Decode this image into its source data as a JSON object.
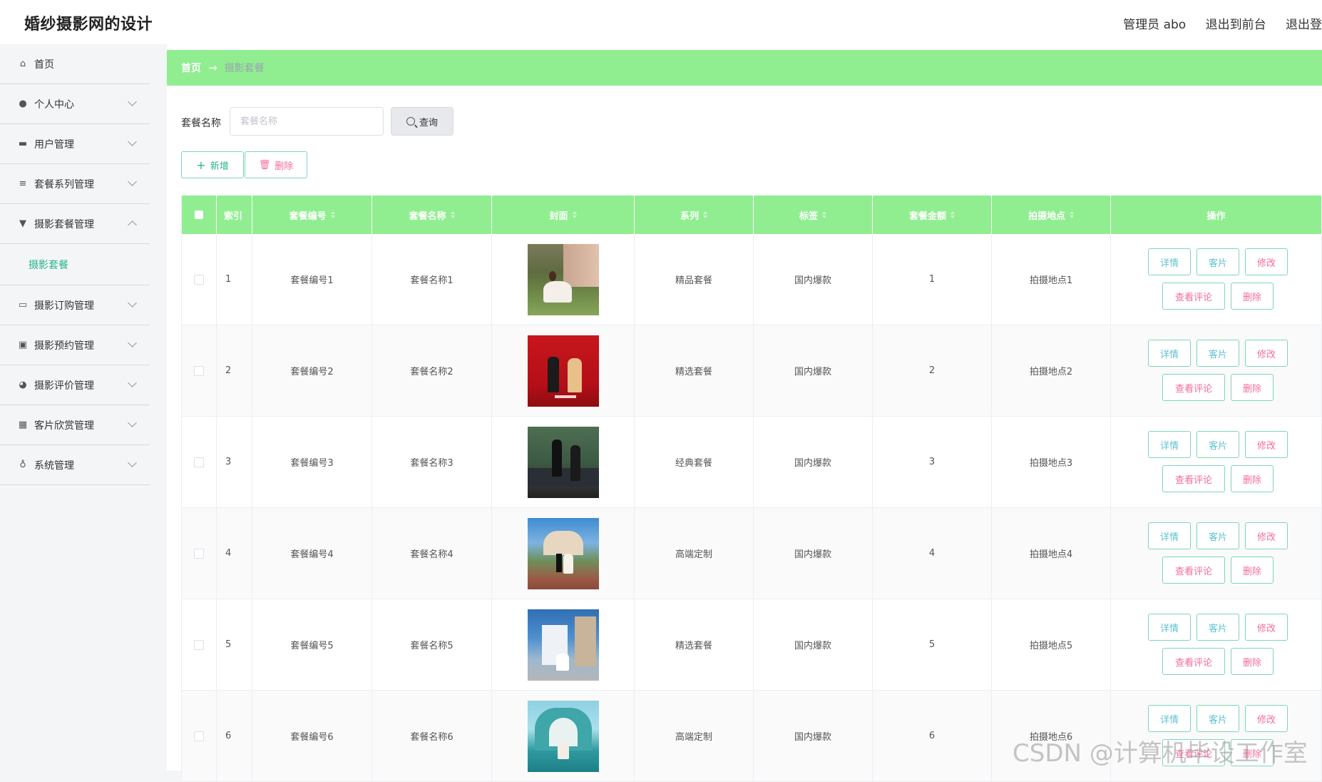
{
  "app": {
    "title": "婚纱摄影网的设计"
  },
  "header": {
    "admin_label": "管理员 abo",
    "to_front": "退出到前台",
    "logout": "退出登"
  },
  "sidebar": {
    "items": [
      {
        "label": "首页",
        "icon": "home-icon"
      },
      {
        "label": "个人中心",
        "icon": "user-icon"
      },
      {
        "label": "用户管理",
        "icon": "monitor-icon"
      },
      {
        "label": "套餐系列管理",
        "icon": "list-icon"
      },
      {
        "label": "摄影套餐管理",
        "icon": "brush-icon"
      },
      {
        "label": "摄影订购管理",
        "icon": "chat-icon"
      },
      {
        "label": "摄影预约管理",
        "icon": "clipboard-icon"
      },
      {
        "label": "摄影评价管理",
        "icon": "balloon-icon"
      },
      {
        "label": "客片欣赏管理",
        "icon": "grid-icon"
      },
      {
        "label": "系统管理",
        "icon": "mic-icon"
      }
    ],
    "active_sub": "摄影套餐"
  },
  "breadcrumb": {
    "home": "首页",
    "current": "摄影套餐"
  },
  "search": {
    "label": "套餐名称",
    "placeholder": "套餐名称",
    "value": "",
    "button": "查询"
  },
  "actions": {
    "add": "新增",
    "delete": "删除"
  },
  "table": {
    "headers": {
      "index": "索引",
      "code": "套餐编号",
      "name": "套餐名称",
      "cover": "封面",
      "series": "系列",
      "tag": "标签",
      "price": "套餐金额",
      "place": "拍摄地点",
      "ops": "操作"
    },
    "row_buttons": {
      "detail": "详情",
      "sample": "客片",
      "edit": "修改",
      "review": "查看评论",
      "delete": "删除"
    },
    "rows": [
      {
        "index": "1",
        "code": "套餐编号1",
        "name": "套餐名称1",
        "series": "精品套餐",
        "tag": "国内爆款",
        "price": "1",
        "place": "拍摄地点1"
      },
      {
        "index": "2",
        "code": "套餐编号2",
        "name": "套餐名称2",
        "series": "精选套餐",
        "tag": "国内爆款",
        "price": "2",
        "place": "拍摄地点2"
      },
      {
        "index": "3",
        "code": "套餐编号3",
        "name": "套餐名称3",
        "series": "经典套餐",
        "tag": "国内爆款",
        "price": "3",
        "place": "拍摄地点3"
      },
      {
        "index": "4",
        "code": "套餐编号4",
        "name": "套餐名称4",
        "series": "高端定制",
        "tag": "国内爆款",
        "price": "4",
        "place": "拍摄地点4"
      },
      {
        "index": "5",
        "code": "套餐编号5",
        "name": "套餐名称5",
        "series": "精选套餐",
        "tag": "国内爆款",
        "price": "5",
        "place": "拍摄地点5"
      },
      {
        "index": "6",
        "code": "套餐编号6",
        "name": "套餐名称6",
        "series": "高端定制",
        "tag": "国内爆款",
        "price": "6",
        "place": "拍摄地点6"
      }
    ]
  },
  "watermark": "CSDN @计算机毕设工作室",
  "colors": {
    "accent_green": "#90ee90",
    "teal": "#2bb38c",
    "pink": "#f56c9b",
    "cyan": "#5ec2d1"
  }
}
